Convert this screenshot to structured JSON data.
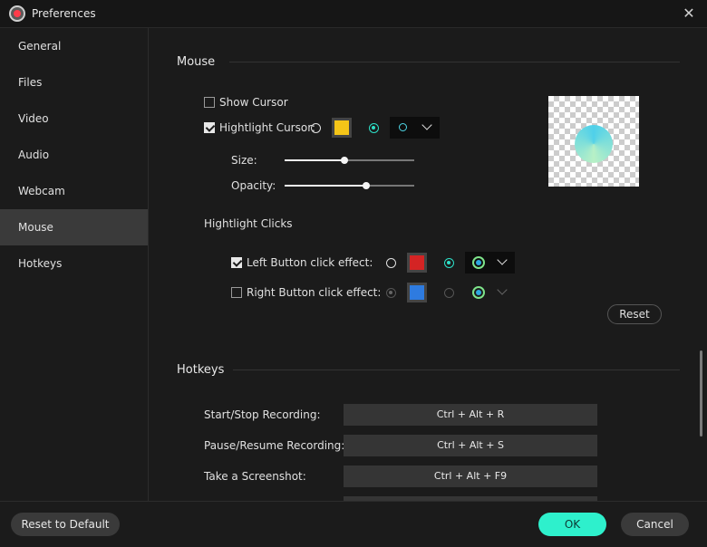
{
  "window": {
    "title": "Preferences"
  },
  "sidebar": {
    "items": [
      {
        "label": "General"
      },
      {
        "label": "Files"
      },
      {
        "label": "Video"
      },
      {
        "label": "Audio"
      },
      {
        "label": "Webcam"
      },
      {
        "label": "Mouse",
        "active": true
      },
      {
        "label": "Hotkeys"
      }
    ]
  },
  "mouse": {
    "title": "Mouse",
    "show_cursor": {
      "label": "Show Cursor",
      "checked": false
    },
    "highlight_cursor": {
      "label": "Hightlight Cursor:",
      "checked": true,
      "color": "#f5c518",
      "style_selected": true
    },
    "size": {
      "label": "Size:",
      "value": 0.46
    },
    "opacity": {
      "label": "Opacity:",
      "value": 0.63
    },
    "highlight_clicks": {
      "label": "Hightlight Clicks"
    },
    "left_click": {
      "label": "Left Button click effect:",
      "checked": true,
      "color": "#d42424"
    },
    "right_click": {
      "label": "Right Button click effect:",
      "checked": false,
      "color": "#2e7be0"
    },
    "reset_label": "Reset"
  },
  "hotkeys": {
    "title": "Hotkeys",
    "items": [
      {
        "label": "Start/Stop Recording:",
        "keys": "Ctrl + Alt + R"
      },
      {
        "label": "Pause/Resume Recording:",
        "keys": "Ctrl + Alt + S"
      },
      {
        "label": "Take a Screenshot:",
        "keys": "Ctrl + Alt + F9"
      }
    ]
  },
  "footer": {
    "reset_default": "Reset to Default",
    "ok": "OK",
    "cancel": "Cancel"
  },
  "colors": {
    "accent": "#2ef0cc"
  }
}
